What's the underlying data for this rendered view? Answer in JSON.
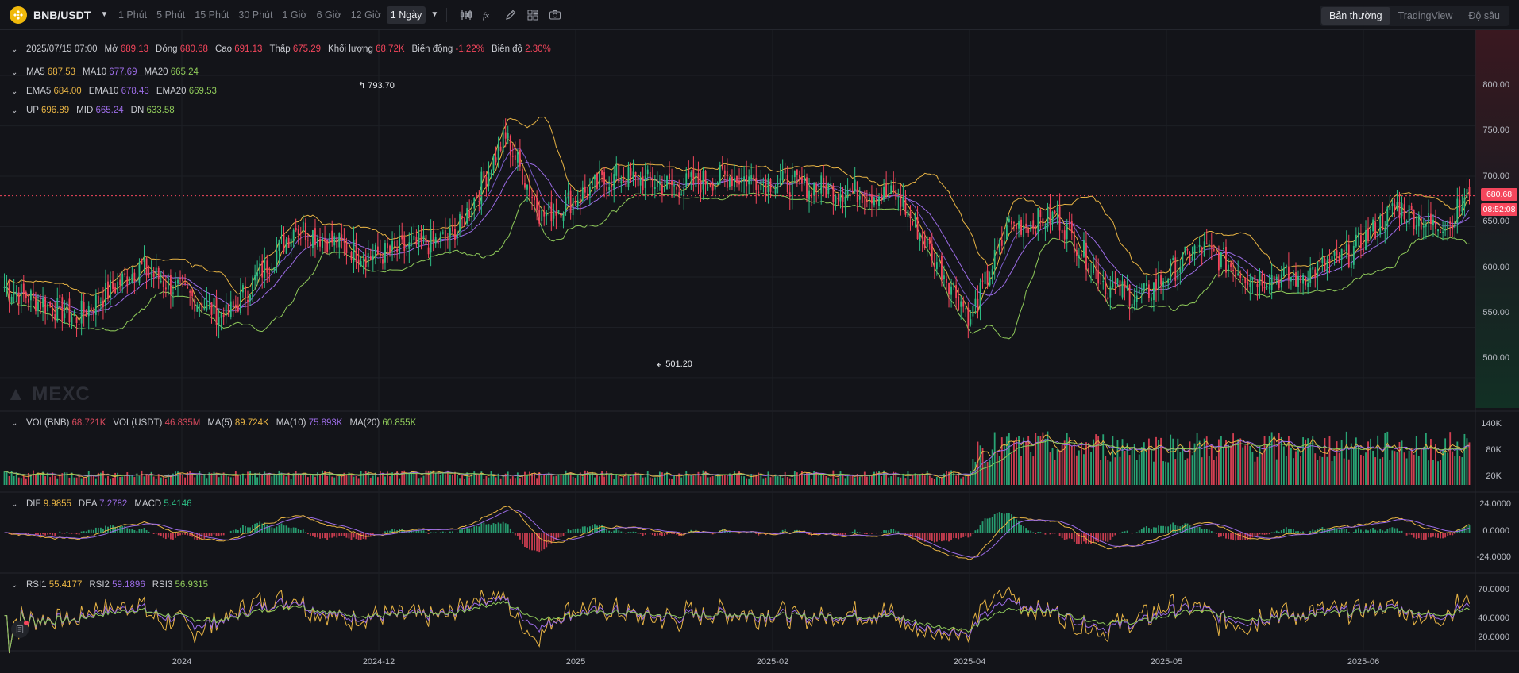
{
  "toolbar": {
    "symbol": "BNB/USDT",
    "intervals": [
      "1 Phút",
      "5 Phút",
      "15 Phút",
      "30 Phút",
      "1 Giờ",
      "6 Giờ",
      "12 Giờ",
      "1 Ngày"
    ],
    "active_interval": "1 Ngày",
    "view_tabs": [
      "Bản thường",
      "TradingView",
      "Độ sâu"
    ],
    "active_view": "Bản thường",
    "tools": [
      "indicator-icon",
      "formula-icon",
      "pencil-icon",
      "layout-icon",
      "camera-icon"
    ]
  },
  "ohlc": {
    "date": "2025/07/15 07:00",
    "open_label": "Mở",
    "open": "689.13",
    "close_label": "Đóng",
    "close": "680.68",
    "high_label": "Cao",
    "high": "691.13",
    "low_label": "Thấp",
    "low": "675.29",
    "volume_label": "Khối lượng",
    "volume": "68.72K",
    "change_label": "Biến động",
    "change": "-1.22%",
    "amplitude_label": "Biên độ",
    "amplitude": "2.30%"
  },
  "ma": {
    "ma5_label": "MA5",
    "ma5": "687.53",
    "ma10_label": "MA10",
    "ma10": "677.69",
    "ma20_label": "MA20",
    "ma20": "665.24"
  },
  "ema": {
    "ema5_label": "EMA5",
    "ema5": "684.00",
    "ema10_label": "EMA10",
    "ema10": "678.43",
    "ema20_label": "EMA20",
    "ema20": "669.53"
  },
  "boll": {
    "up_label": "UP",
    "up": "696.89",
    "mid_label": "MID",
    "mid": "665.24",
    "dn_label": "DN",
    "dn": "633.58"
  },
  "vol": {
    "bnb_label": "VOL(BNB)",
    "bnb": "68.721K",
    "usdt_label": "VOL(USDT)",
    "usdt": "46.835M",
    "ma5_label": "MA(5)",
    "ma5": "89.724K",
    "ma10_label": "MA(10)",
    "ma10": "75.893K",
    "ma20_label": "MA(20)",
    "ma20": "60.855K"
  },
  "macd": {
    "dif_label": "DIF",
    "dif": "9.9855",
    "dea_label": "DEA",
    "dea": "7.2782",
    "macd_label": "MACD",
    "macd": "5.4146"
  },
  "rsi": {
    "rsi1_label": "RSI1",
    "rsi1": "55.4177",
    "rsi2_label": "RSI2",
    "rsi2": "59.1896",
    "rsi3_label": "RSI3",
    "rsi3": "56.9315"
  },
  "price_axis": [
    "800.00",
    "750.00",
    "700.00",
    "650.00",
    "600.00",
    "550.00",
    "500.00"
  ],
  "volume_axis": [
    "140K",
    "80K",
    "20K"
  ],
  "macd_axis": [
    "24.0000",
    "0.0000",
    "-24.0000"
  ],
  "rsi_axis": [
    "70.0000",
    "40.0000",
    "20.0000"
  ],
  "time_axis": [
    "2024",
    "2024-12",
    "2025",
    "2025-02",
    "2025-04",
    "2025-05",
    "2025-06"
  ],
  "last_price": "680.68",
  "countdown": "08:52:08",
  "high_marker": "793.70",
  "low_marker": "501.20",
  "watermark": "MEXC",
  "colors": {
    "up": "#2dbd85",
    "down": "#f5465c",
    "ma5": "#e7b344",
    "ma10": "#9c6ce6",
    "ma20": "#8fca5a",
    "background": "#131419"
  },
  "chart_data": {
    "type": "candlestick",
    "price_range": [
      470,
      845
    ],
    "volume_range": [
      0,
      150000
    ],
    "macd_range": [
      -30,
      30
    ],
    "rsi_range": [
      10,
      95
    ],
    "grid": true,
    "x_start": "2023-11-15",
    "x_end": "2025-07-15",
    "anchors": [
      {
        "t": "2023-11-15",
        "p": 590
      },
      {
        "t": "2023-12-15",
        "p": 560
      },
      {
        "t": "2024-01-10",
        "p": 610
      },
      {
        "t": "2024-02-15",
        "p": 560
      },
      {
        "t": "2024-03-15",
        "p": 650
      },
      {
        "t": "2024-04-15",
        "p": 620
      },
      {
        "t": "2024-05-20",
        "p": 640
      },
      {
        "t": "2024-06-10",
        "p": 740
      },
      {
        "t": "2024-06-25",
        "p": 660
      },
      {
        "t": "2024-07-25",
        "p": 700
      },
      {
        "t": "2024-08-20",
        "p": 690
      },
      {
        "t": "2024-09-10",
        "p": 700
      },
      {
        "t": "2024-10-15",
        "p": 690
      },
      {
        "t": "2024-11-20",
        "p": 680
      },
      {
        "t": "2024-12-05",
        "p": 620
      },
      {
        "t": "2024-12-20",
        "p": 560
      },
      {
        "t": "2025-01-05",
        "p": 650
      },
      {
        "t": "2025-01-25",
        "p": 660
      },
      {
        "t": "2025-02-15",
        "p": 590
      },
      {
        "t": "2025-03-01",
        "p": 580
      },
      {
        "t": "2025-03-25",
        "p": 630
      },
      {
        "t": "2025-04-15",
        "p": 600
      },
      {
        "t": "2025-05-05",
        "p": 600
      },
      {
        "t": "2025-05-25",
        "p": 620
      },
      {
        "t": "2025-06-15",
        "p": 670
      },
      {
        "t": "2025-06-30",
        "p": 650
      },
      {
        "t": "2025-07-08",
        "p": 660
      },
      {
        "t": "2025-07-15",
        "p": 680.68
      }
    ]
  }
}
